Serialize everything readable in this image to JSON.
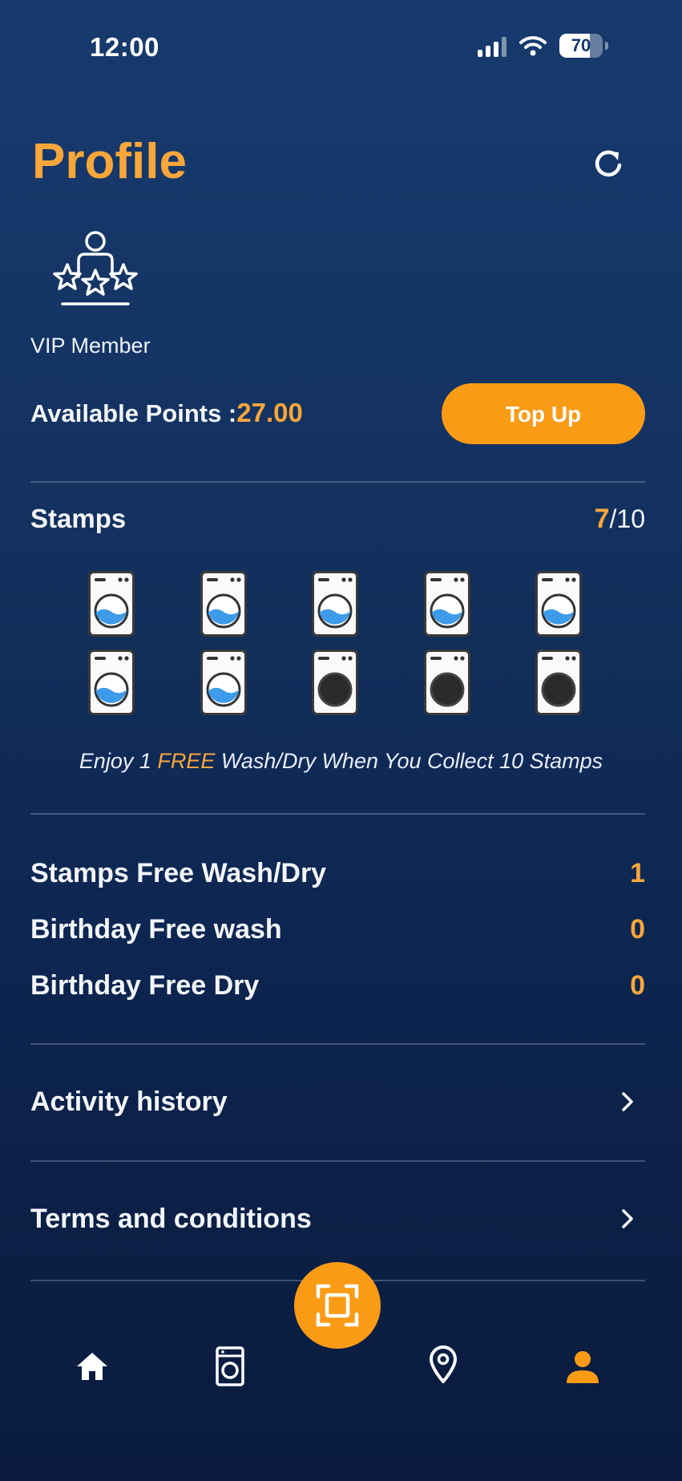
{
  "status_bar": {
    "time": "12:00",
    "battery": "70",
    "battery_level": 0.7
  },
  "header": {
    "title": "Profile",
    "refresh_icon": "refresh-icon"
  },
  "member": {
    "tier": "VIP Member",
    "icon": "vip-member-icon"
  },
  "points": {
    "label": "Available Points :",
    "value": "27.00",
    "topup_label": "Top Up"
  },
  "stamps": {
    "title": "Stamps",
    "collected": "7",
    "total": "/10",
    "collected_count": 7,
    "total_count": 10,
    "promo": {
      "prefix": "Enjoy 1 ",
      "highlight": "FREE",
      "suffix": " Wash/Dry When You Collect 10 Stamps"
    }
  },
  "rewards": [
    {
      "label": "Stamps Free Wash/Dry",
      "value": "1"
    },
    {
      "label": "Birthday Free wash",
      "value": "0"
    },
    {
      "label": "Birthday Free Dry",
      "value": "0"
    }
  ],
  "links": [
    {
      "label": "Activity history"
    },
    {
      "label": "Terms and conditions"
    }
  ],
  "bottom_nav": {
    "items": [
      "home-icon",
      "washing-machine-icon",
      "scan-icon",
      "location-pin-icon",
      "profile-icon"
    ],
    "active": "profile-icon"
  },
  "colors": {
    "accent": "#fa9b16",
    "highlight_text": "#f7a63a",
    "background": "#13315f",
    "water": "#3d9be9"
  }
}
